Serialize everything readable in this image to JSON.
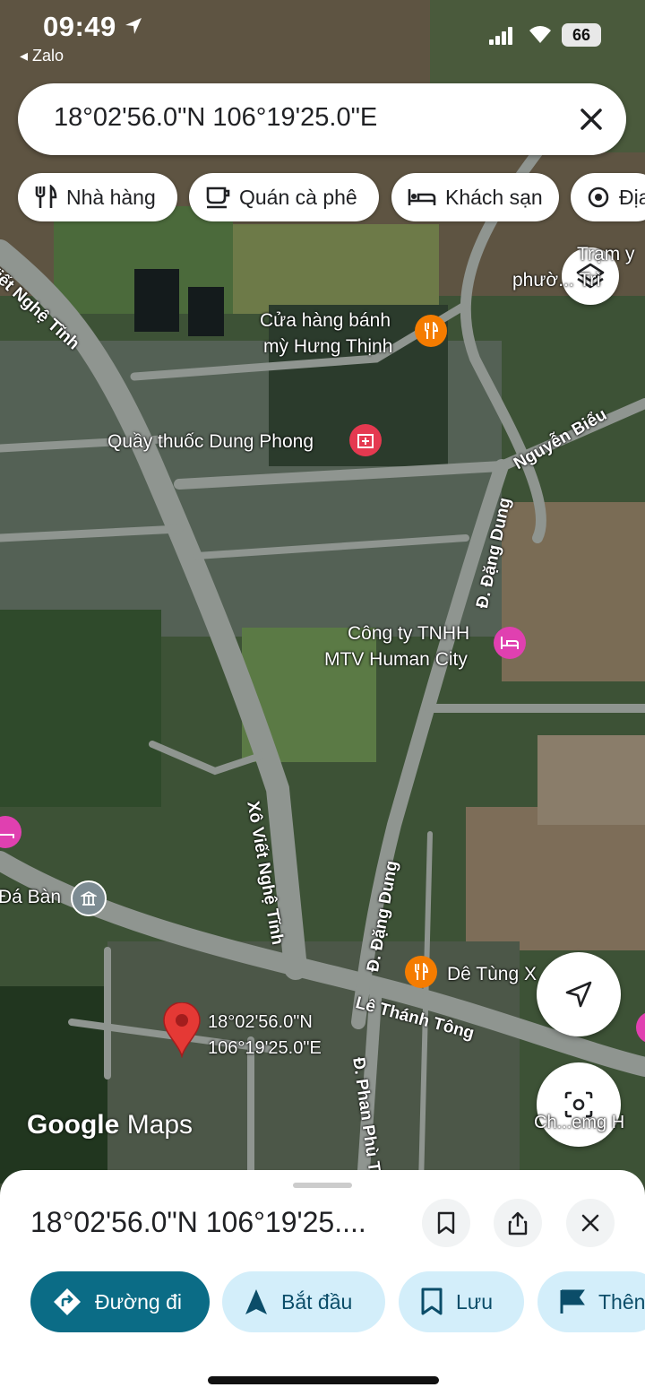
{
  "status_bar": {
    "time": "09:49",
    "back_app": "◂ Zalo",
    "battery": "66"
  },
  "search": {
    "query": "18°02'56.0\"N 106°19'25.0\"E"
  },
  "chips": [
    {
      "label": "Nhà hàng",
      "icon": "restaurant-icon"
    },
    {
      "label": "Quán cà phê",
      "icon": "coffee-icon"
    },
    {
      "label": "Khách sạn",
      "icon": "hotel-icon"
    },
    {
      "label": "Địa",
      "icon": "attraction-icon"
    }
  ],
  "map": {
    "places": {
      "bakery": [
        "Cửa hàng bánh",
        "mỳ Hưng Thịnh"
      ],
      "pharmacy": "Quầy thuốc Dung Phong",
      "company": [
        "Công ty TNHH",
        "MTV Human City"
      ],
      "da_ban": "Đá Bàn",
      "de_tung": "Dê Tùng X",
      "top_right": [
        "Trạm y",
        "phườ... Trì"
      ],
      "bottom_right": "Ch...emg H"
    },
    "roads": {
      "xo_viet_top": "Viết Nghệ Tĩnh",
      "xo_viet": "Xô Viết Nghệ Tĩnh",
      "nguyen_bieu": "Nguyễn Biểu",
      "dang_dung_top": "Đ. Đặng Dung",
      "dang_dung": "Đ. Đặng Dung",
      "le_thanh_tong": "Lê Thánh Tông",
      "phan_phu_tien": "Đ. Phan Phù Tiên"
    },
    "pin_label": [
      "18°02'56.0\"N",
      "106°19'25.0\"E"
    ],
    "watermark_google": "Google",
    "watermark_maps": "Maps"
  },
  "sheet": {
    "title": "18°02'56.0\"N 106°19'25....",
    "actions": [
      {
        "label": "Đường đi",
        "icon": "directions-icon"
      },
      {
        "label": "Bắt đầu",
        "icon": "navigation-icon"
      },
      {
        "label": "Lưu",
        "icon": "bookmark-icon"
      },
      {
        "label": "Thên",
        "icon": "flag-icon"
      }
    ]
  },
  "colors": {
    "primary_action": "#0b6c86",
    "secondary_action": "#d3eefa",
    "pin": "#e53935",
    "restaurant_poi": "#f57c00",
    "hotel_poi": "#e040b0",
    "pharmacy_poi": "#e53950"
  }
}
